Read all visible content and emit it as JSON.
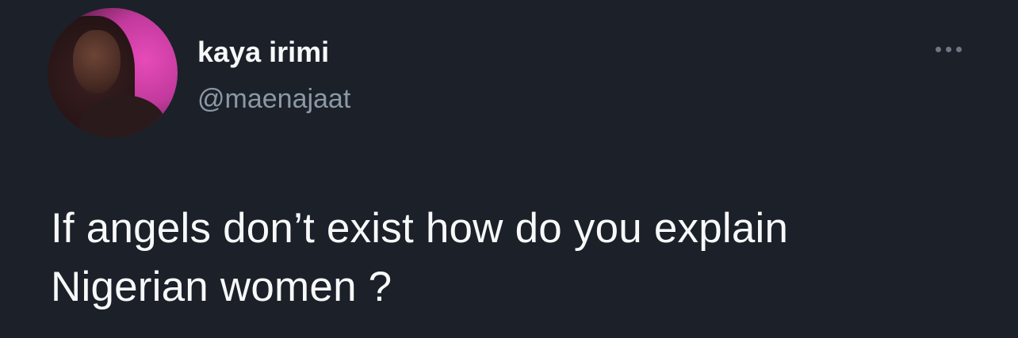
{
  "tweet": {
    "author": {
      "display_name": "kaya irimi",
      "handle": "@maenajaat",
      "avatar_icon": "profile-photo"
    },
    "more_icon": "more-horizontal-icon",
    "text_lines": [
      "If angels don’t exist how do you explain",
      "Nigerian women ?"
    ]
  },
  "colors": {
    "background": "#1b2029",
    "primary_text": "#f7f9f9",
    "secondary_text": "#8b98a5"
  }
}
